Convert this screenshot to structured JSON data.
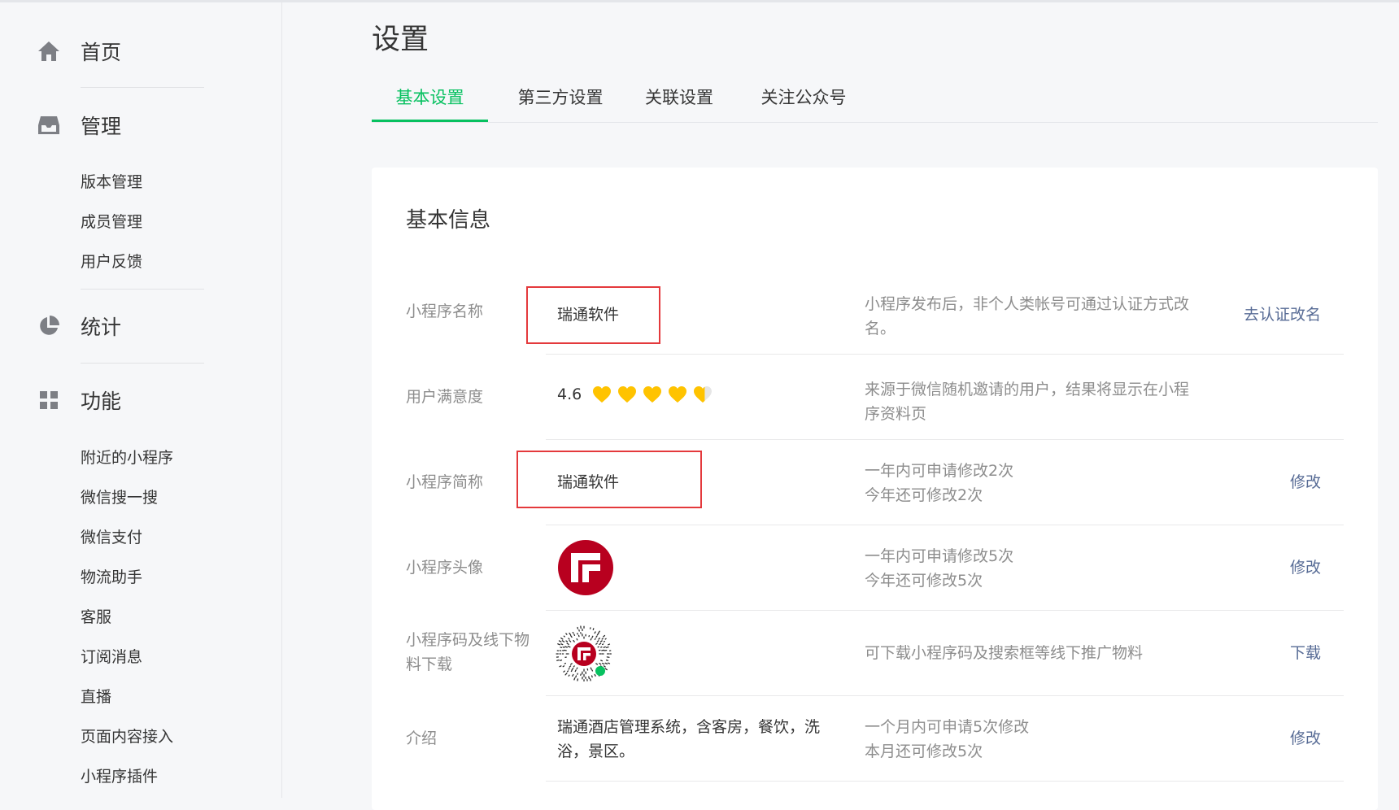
{
  "sidebar": {
    "home": {
      "label": "首页",
      "icon": "home-icon"
    },
    "manage": {
      "label": "管理",
      "icon": "inbox-icon",
      "items": [
        "版本管理",
        "成员管理",
        "用户反馈"
      ]
    },
    "stats": {
      "label": "统计",
      "icon": "pie-chart-icon"
    },
    "features": {
      "label": "功能",
      "icon": "grid-icon",
      "items": [
        "附近的小程序",
        "微信搜一搜",
        "微信支付",
        "物流助手",
        "客服",
        "订阅消息",
        "直播",
        "页面内容接入",
        "小程序插件"
      ]
    }
  },
  "page": {
    "title": "设置"
  },
  "tabs": [
    "基本设置",
    "第三方设置",
    "关联设置",
    "关注公众号"
  ],
  "active_tab": 0,
  "card": {
    "title": "基本信息",
    "rows": [
      {
        "label": "小程序名称",
        "value": "瑞通软件",
        "tip": "小程序发布后，非个人类帐号可通过认证方式改名。",
        "action": "去认证改名"
      },
      {
        "label": "用户满意度",
        "value": "4.6",
        "rating": 4.6,
        "rating_max": 5,
        "tip": "来源于微信随机邀请的用户，结果将显示在小程序资料页",
        "action": ""
      },
      {
        "label": "小程序简称",
        "value": "瑞通软件",
        "tip": "一年内可申请修改2次",
        "tip2": "今年还可修改2次",
        "action": "修改"
      },
      {
        "label": "小程序头像",
        "tip": "一年内可申请修改5次",
        "tip2": "今年还可修改5次",
        "action": "修改"
      },
      {
        "label": "小程序码及线下物料下载",
        "tip": "可下载小程序码及搜索框等线下推广物料",
        "action": "下载"
      },
      {
        "label": "介绍",
        "value": "瑞通酒店管理系统，含客房，餐饮，洗浴，景区。",
        "tip": "一个月内可申请5次修改",
        "tip2": "本月还可修改5次",
        "action": "修改"
      }
    ]
  },
  "colors": {
    "accent": "#07c160",
    "link": "#576b95",
    "heart": "#ffc300",
    "highlight": "#e4393c",
    "logo": "#b8001f"
  }
}
